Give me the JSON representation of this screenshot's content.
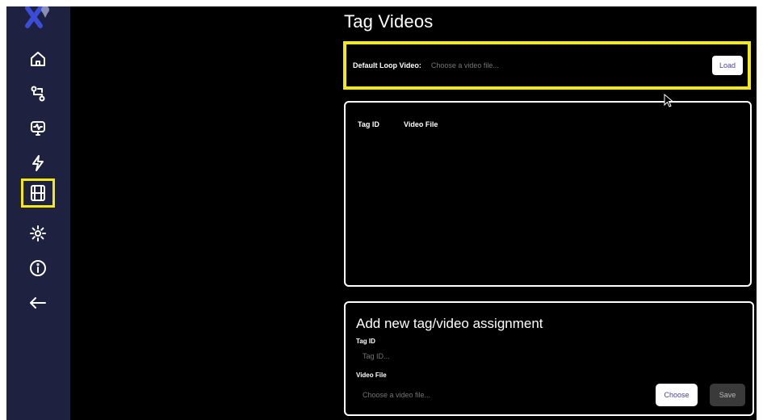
{
  "sidebar": {
    "logo_icon": "logo-x-pin",
    "items": [
      {
        "id": "home",
        "icon": "home-icon"
      },
      {
        "id": "routes",
        "icon": "route-icon"
      },
      {
        "id": "monitor",
        "icon": "monitor-icon"
      },
      {
        "id": "power",
        "icon": "lightning-icon"
      },
      {
        "id": "videos",
        "icon": "film-icon",
        "active": true
      },
      {
        "id": "settings",
        "icon": "gear-icon"
      },
      {
        "id": "info",
        "icon": "info-icon"
      },
      {
        "id": "back",
        "icon": "arrow-left-icon"
      }
    ]
  },
  "page": {
    "title": "Tag Videos"
  },
  "loop_video": {
    "label": "Default Loop Video:",
    "placeholder": "Choose a video file...",
    "load_label": "Load"
  },
  "table": {
    "columns": [
      "Tag ID",
      "Video File"
    ],
    "rows": []
  },
  "add_form": {
    "title": "Add new tag/video assignment",
    "tag_label": "Tag ID",
    "tag_placeholder": "Tag ID...",
    "file_label": "Video File",
    "file_placeholder": "Choose a video file...",
    "choose_label": "Choose",
    "save_label": "Save"
  },
  "colors": {
    "sidebar": "#1e2140",
    "highlight": "#f4ea10",
    "accent": "#4a3fa0",
    "logo": "#3b4dd8"
  }
}
